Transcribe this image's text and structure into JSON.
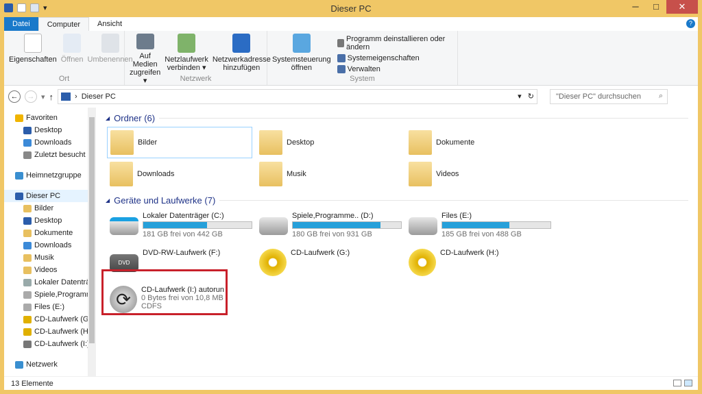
{
  "window": {
    "title": "Dieser PC",
    "minimize": "─",
    "maximize": "□",
    "close": "✕"
  },
  "tabs": [
    {
      "label": "Datei"
    },
    {
      "label": "Computer"
    },
    {
      "label": "Ansicht"
    }
  ],
  "ribbon": {
    "groups": [
      {
        "name": "Ort",
        "items": [
          {
            "label": "Eigenschaften",
            "enabled": true
          },
          {
            "label": "Öffnen",
            "enabled": false
          },
          {
            "label": "Umbenennen",
            "enabled": false
          }
        ]
      },
      {
        "name": "Netzwerk",
        "items": [
          {
            "label1": "Auf Medien",
            "label2": "zugreifen ▾"
          },
          {
            "label1": "Netzlaufwerk",
            "label2": "verbinden ▾"
          },
          {
            "label1": "Netzwerkadresse",
            "label2": "hinzufügen"
          }
        ]
      },
      {
        "name": "System",
        "big": {
          "label1": "Systemsteuerung",
          "label2": "öffnen"
        },
        "small": [
          "Programm deinstallieren oder ändern",
          "Systemeigenschaften",
          "Verwalten"
        ]
      }
    ]
  },
  "address": {
    "path": "Dieser PC",
    "separator": "›",
    "search_placeholder": "\"Dieser PC\" durchsuchen"
  },
  "sidebar": {
    "items": [
      {
        "label": "Favoriten",
        "level": 0,
        "color": "#f0b400"
      },
      {
        "label": "Desktop",
        "level": 1,
        "color": "#2b5dab"
      },
      {
        "label": "Downloads",
        "level": 1,
        "color": "#3c8ad8"
      },
      {
        "label": "Zuletzt besucht",
        "level": 1,
        "color": "#888"
      },
      {
        "gap": true
      },
      {
        "label": "Heimnetzgruppe",
        "level": 0,
        "color": "#3a8fd0"
      },
      {
        "gap": true
      },
      {
        "label": "Dieser PC",
        "level": 0,
        "color": "#2b5dab",
        "selected": true
      },
      {
        "label": "Bilder",
        "level": 1,
        "color": "#e8c060"
      },
      {
        "label": "Desktop",
        "level": 1,
        "color": "#2b5dab"
      },
      {
        "label": "Dokumente",
        "level": 1,
        "color": "#e8c060"
      },
      {
        "label": "Downloads",
        "level": 1,
        "color": "#3c8ad8"
      },
      {
        "label": "Musik",
        "level": 1,
        "color": "#e8c060"
      },
      {
        "label": "Videos",
        "level": 1,
        "color": "#e8c060"
      },
      {
        "label": "Lokaler Datenträg",
        "level": 1,
        "color": "#9aa"
      },
      {
        "label": "Spiele,Programm",
        "level": 1,
        "color": "#aaa"
      },
      {
        "label": "Files (E:)",
        "level": 1,
        "color": "#aaa"
      },
      {
        "label": "CD-Laufwerk (G:)",
        "level": 1,
        "color": "#e0b000"
      },
      {
        "label": "CD-Laufwerk (H:)",
        "level": 1,
        "color": "#e0b000"
      },
      {
        "label": "CD-Laufwerk (I:)",
        "level": 1,
        "color": "#777"
      },
      {
        "gap": true
      },
      {
        "label": "Netzwerk",
        "level": 0,
        "color": "#3a8fd0"
      }
    ]
  },
  "main": {
    "folders_header": "Ordner (6)",
    "folders": [
      "Bilder",
      "Desktop",
      "Dokumente",
      "Downloads",
      "Musik",
      "Videos"
    ],
    "drives_header": "Geräte und Laufwerke (7)",
    "drives": [
      {
        "name": "Lokaler Datenträger (C:)",
        "free": "181 GB frei von 442 GB",
        "used_percent": 59,
        "icon": "windows-drive"
      },
      {
        "name": "Spiele,Programme.. (D:)",
        "free": "180 GB frei von 931 GB",
        "used_percent": 81,
        "icon": "hdd"
      },
      {
        "name": "Files (E:)",
        "free": "185 GB frei von 488 GB",
        "used_percent": 62,
        "icon": "hdd"
      },
      {
        "name": "DVD-RW-Laufwerk (F:)",
        "icon": "dvd-drive"
      },
      {
        "name": "CD-Laufwerk (G:)",
        "icon": "cd-drive"
      },
      {
        "name": "CD-Laufwerk (H:)",
        "icon": "cd-drive"
      },
      {
        "name": "CD-Laufwerk (I:) autorun",
        "free": "0 Bytes frei von 10,8 MB",
        "fs": "CDFS",
        "icon": "autorun-disc",
        "highlighted": true
      }
    ]
  },
  "status": {
    "count": "13 Elemente"
  },
  "colors": {
    "titlebar": "#f0c766",
    "accent": "#1979ca",
    "bar": "#26a0da",
    "highlight": "#c8202a"
  }
}
